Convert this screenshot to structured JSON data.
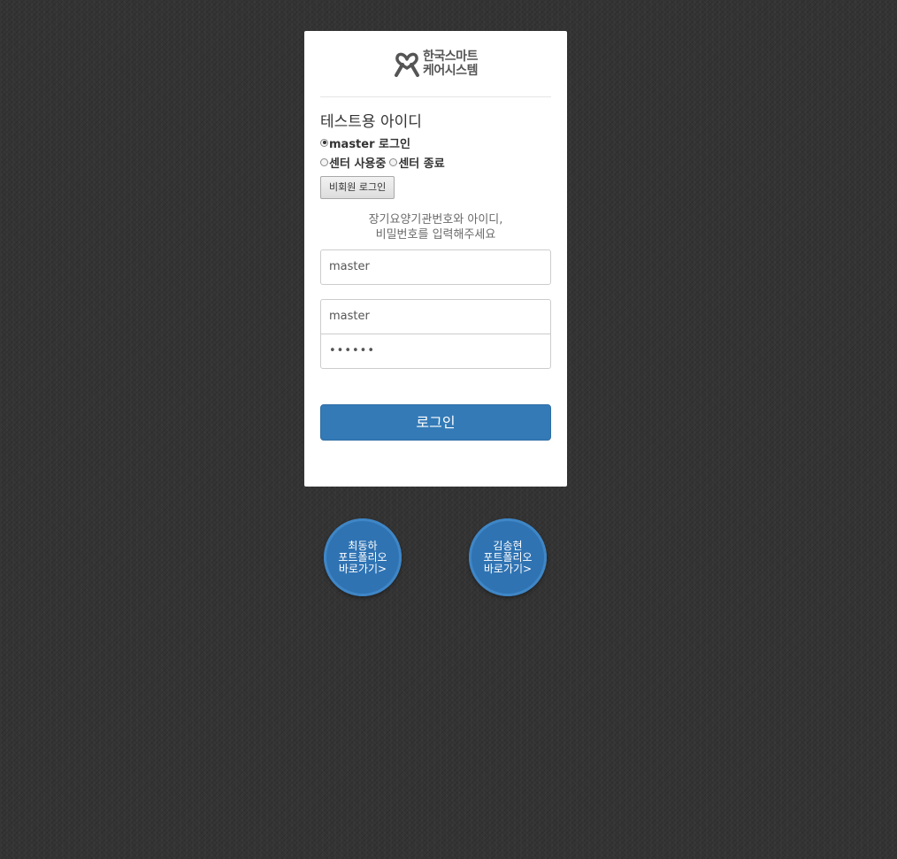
{
  "logo": {
    "line1": "한국스마트",
    "line2": "케어시스템"
  },
  "test_section": {
    "title": "테스트용 아이디",
    "radio_master": "master 로그인",
    "radio_center_active": "센터 사용중",
    "radio_center_ended": "센터 종료",
    "guest_button": "비회원 로그인"
  },
  "instructions": {
    "line1": "장기요양기관번호와 아이디,",
    "line2": "비밀번호를 입력해주세요"
  },
  "form": {
    "institution_number": "master",
    "user_id": "master",
    "password_masked": "••••••",
    "login_button": "로그인"
  },
  "portfolio_links": [
    {
      "name": "최동하",
      "line2": "포트폴리오",
      "line3": "바로가기>"
    },
    {
      "name": "김송현",
      "line2": "포트폴리오",
      "line3": "바로가기>"
    }
  ],
  "colors": {
    "background": "#333333",
    "primary": "#337ab7",
    "portfolio_circle": "#2f73b3"
  }
}
